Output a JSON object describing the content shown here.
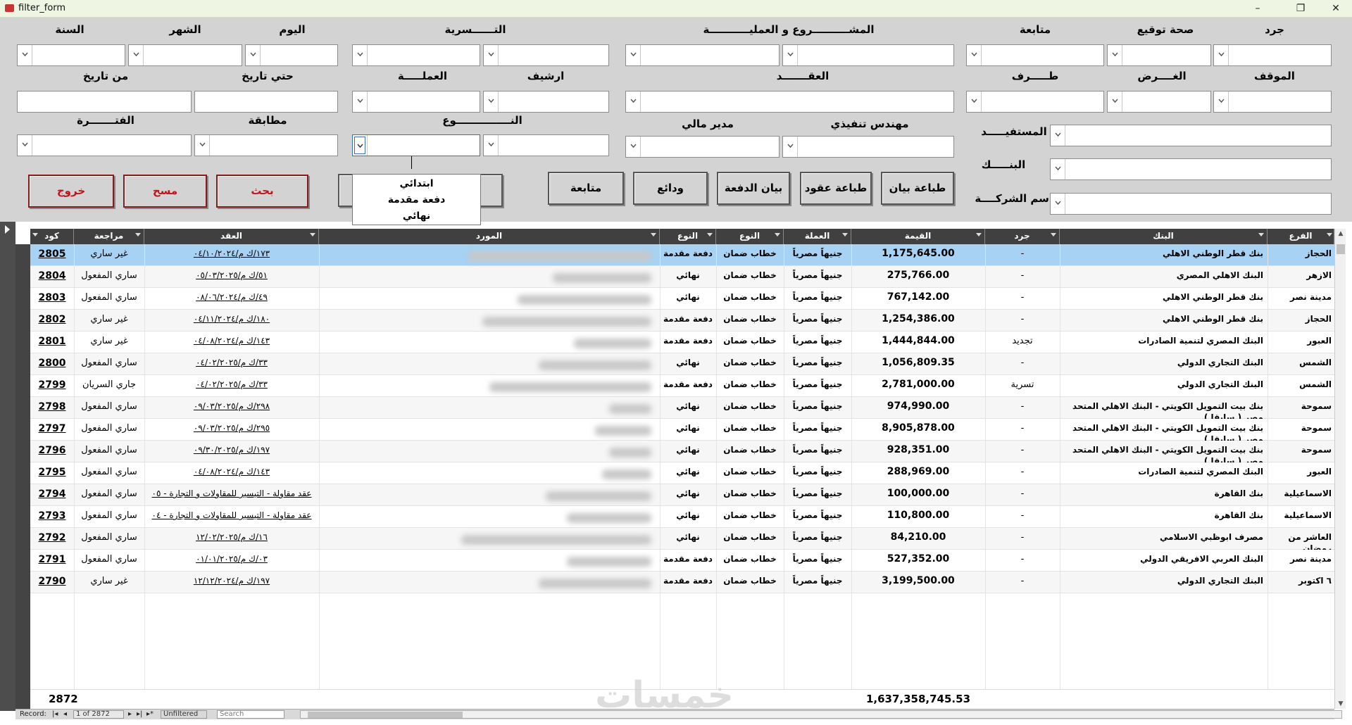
{
  "window": {
    "title": "filter_form",
    "minimize": "–",
    "maximize": "❐",
    "close": "✕"
  },
  "form": {
    "labels": {
      "jard": "جرد",
      "sehet_tawqee": "صحة توقيع",
      "motaba3a": "متابعة",
      "project": "المشــــــــــروع و العمليـــــــــــة",
      "tasrya": "التــــــسرية",
      "day": "اليوم",
      "month": "الشهر",
      "year": "السنة",
      "mawqef": "الموقف",
      "gharad": "الغــــرض",
      "taraf": "طـــــرف",
      "aqd": "العقـــــــد",
      "archive": "ارشيف",
      "currency": "العملـــــة",
      "to_date": "حتي تاريخ",
      "from_date": "من تاريخ",
      "mostafeed": "المستفيـــــد",
      "engineer": "مهندس تنفيذي",
      "fin_manager": "مدير مالي",
      "type": "النـــــــــــــــوع",
      "match": "مطابقة",
      "period": "الفتـــــــرة",
      "bank": "البنـــــك",
      "company": "اسم الشركــــة"
    },
    "buttons": {
      "print_statement": "طباعة بيان",
      "print_contracts": "طباعة عقود",
      "payment_statement": "بيان الدفعة",
      "deposits": "ودائع",
      "follow_up": "متابعة",
      "search": "بحث",
      "clear": "مسح",
      "exit": "خروج"
    },
    "type_dropdown_options": [
      "ابتدائي",
      "دفعة مقدمة",
      "نهائي"
    ]
  },
  "grid": {
    "headers": {
      "code": "كود",
      "review": "مراجعة",
      "contract": "العقد",
      "supplier": "المورد",
      "type2": "النوع",
      "type": "النوع",
      "currency": "العملة",
      "value": "القيمة",
      "jard": "جرد",
      "bank": "البنك",
      "branch": "الفرع"
    },
    "rows": [
      {
        "code": "2805",
        "review": "غير ساري",
        "contract": "١٧٣/ك م/٠٤/١٠/٢٠٢٤",
        "type2": "دفعة مقدمة",
        "type": "خطاب ضمان",
        "currency": "جنيهاً مصرياً",
        "value": "1,175,645.00",
        "jard": "-",
        "bank": "بنك قطر الوطني الاهلي",
        "branch": "الحجاز"
      },
      {
        "code": "2804",
        "review": "ساري المفعول",
        "contract": "٥١/ك م/٠٥/٠٣/٢٠٢٥",
        "type2": "نهائي",
        "type": "خطاب ضمان",
        "currency": "جنيهاً مصرياً",
        "value": "275,766.00",
        "jard": "-",
        "bank": "البنك الاهلي المصري",
        "branch": "الازهر"
      },
      {
        "code": "2803",
        "review": "ساري المفعول",
        "contract": "٤٩/ك م/٠٨/٠٦/٢٠٢٤",
        "type2": "نهائي",
        "type": "خطاب ضمان",
        "currency": "جنيهاً مصرياً",
        "value": "767,142.00",
        "jard": "-",
        "bank": "بنك قطر الوطني الاهلي",
        "branch": "مدينة نصر"
      },
      {
        "code": "2802",
        "review": "غير ساري",
        "contract": "١٨٠/ك م/٠٤/١١/٢٠٢٤",
        "type2": "دفعة مقدمة",
        "type": "خطاب ضمان",
        "currency": "جنيهاً مصرياً",
        "value": "1,254,386.00",
        "jard": "-",
        "bank": "بنك قطر الوطني الاهلي",
        "branch": "الحجاز"
      },
      {
        "code": "2801",
        "review": "غير ساري",
        "contract": "١٤٣/ك م/٠٤/٠٨/٢٠٢٤",
        "type2": "دفعة مقدمة",
        "type": "خطاب ضمان",
        "currency": "جنيهاً مصرياً",
        "value": "1,444,844.00",
        "jard": "تجديد",
        "bank": "البنك المصري لتنمية الصادرات",
        "branch": "العبور"
      },
      {
        "code": "2800",
        "review": "ساري المفعول",
        "contract": "٣٣/ك م/٠٤/٠٢/٢٠٢٥",
        "type2": "نهائي",
        "type": "خطاب ضمان",
        "currency": "جنيهاً مصرياً",
        "value": "1,056,809.35",
        "jard": "-",
        "bank": "البنك التجاري الدولي",
        "branch": "الشمس"
      },
      {
        "code": "2799",
        "review": "جاري السريان",
        "contract": "٣٣/ك م/٠٤/٠٢/٢٠٢٥",
        "type2": "دفعة مقدمة",
        "type": "خطاب ضمان",
        "currency": "جنيهاً مصرياً",
        "value": "2,781,000.00",
        "jard": "تسرية",
        "bank": "البنك التجاري الدولي",
        "branch": "الشمس"
      },
      {
        "code": "2798",
        "review": "ساري المفعول",
        "contract": "٢٩٨/ك م/٠٩/٠٣/٢٠٢٥",
        "type2": "نهائي",
        "type": "خطاب ضمان",
        "currency": "جنيهاً مصرياً",
        "value": "974,990.00",
        "jard": "-",
        "bank": "بنك بيت التمويل الكويتي - البنك الاهلي المتحد مصر ( سابقا )",
        "branch": "سموحة"
      },
      {
        "code": "2797",
        "review": "ساري المفعول",
        "contract": "٢٩٥/ك م/٠٩/٠٣/٢٠٢٥",
        "type2": "نهائي",
        "type": "خطاب ضمان",
        "currency": "جنيهاً مصرياً",
        "value": "8,905,878.00",
        "jard": "-",
        "bank": "بنك بيت التمويل الكويتي - البنك الاهلي المتحد مصر ( سابقا )",
        "branch": "سموحة"
      },
      {
        "code": "2796",
        "review": "ساري المفعول",
        "contract": "١٩٧/ك م/٠٩/٣٠/٢٠٢٥",
        "type2": "نهائي",
        "type": "خطاب ضمان",
        "currency": "جنيهاً مصرياً",
        "value": "928,351.00",
        "jard": "-",
        "bank": "بنك بيت التمويل الكويتي - البنك الاهلي المتحد مصر ( سابقا )",
        "branch": "سموحة"
      },
      {
        "code": "2795",
        "review": "ساري المفعول",
        "contract": "١٤٣/ك م/٠٤/٠٨/٢٠٢٤",
        "type2": "نهائي",
        "type": "خطاب ضمان",
        "currency": "جنيهاً مصرياً",
        "value": "288,969.00",
        "jard": "-",
        "bank": "البنك المصري لتنمية الصادرات",
        "branch": "العبور"
      },
      {
        "code": "2794",
        "review": "ساري المفعول",
        "contract": "عقد مقاولة - التيسير للمقاولات و التجارة - ٠٥",
        "type2": "نهائي",
        "type": "خطاب ضمان",
        "currency": "جنيهاً مصرياً",
        "value": "100,000.00",
        "jard": "-",
        "bank": "بنك القاهرة",
        "branch": "الاسماعيلية"
      },
      {
        "code": "2793",
        "review": "ساري المفعول",
        "contract": "عقد مقاولة - التيسير للمقاولات و التجارة - ٠٤",
        "type2": "نهائي",
        "type": "خطاب ضمان",
        "currency": "جنيهاً مصرياً",
        "value": "110,800.00",
        "jard": "-",
        "bank": "بنك القاهرة",
        "branch": "الاسماعيلية"
      },
      {
        "code": "2792",
        "review": "ساري المفعول",
        "contract": "١٦/ك م/١٢/٠٢/٢٠٢٥",
        "type2": "نهائي",
        "type": "خطاب ضمان",
        "currency": "جنيهاً مصرياً",
        "value": "84,210.00",
        "jard": "-",
        "bank": "مصرف ابوظبي الاسلامي",
        "branch": "العاشر من رمضان"
      },
      {
        "code": "2791",
        "review": "ساري المفعول",
        "contract": "٠٣/ك م/٠١/٠١/٢٠٢٥",
        "type2": "دفعة مقدمة",
        "type": "خطاب ضمان",
        "currency": "جنيهاً مصرياً",
        "value": "527,352.00",
        "jard": "-",
        "bank": "البنك العربي الافريقي الدولي",
        "branch": "مدينة نصر"
      },
      {
        "code": "2790",
        "review": "غير ساري",
        "contract": "١٩٧/ك م/١٢/١٢/٢٠٢٤",
        "type2": "دفعة مقدمة",
        "type": "خطاب ضمان",
        "currency": "جنيهاً مصرياً",
        "value": "3,199,500.00",
        "jard": "-",
        "bank": "البنك التجاري الدولي",
        "branch": "٦ اكتوبر"
      }
    ],
    "totals": {
      "count": "2872",
      "sum": "1,637,358,745.53"
    }
  },
  "navbar": {
    "record_label": "Record:",
    "record_of": "1 of 2872",
    "filter_status": "Unfiltered",
    "search_placeholder": "Search"
  },
  "watermark": "خمسات",
  "colors": {
    "form_bg": "#d3d3d3",
    "selected_row": "#a7d2f3",
    "header_bg": "#404040",
    "danger_text": "#c0141b"
  }
}
